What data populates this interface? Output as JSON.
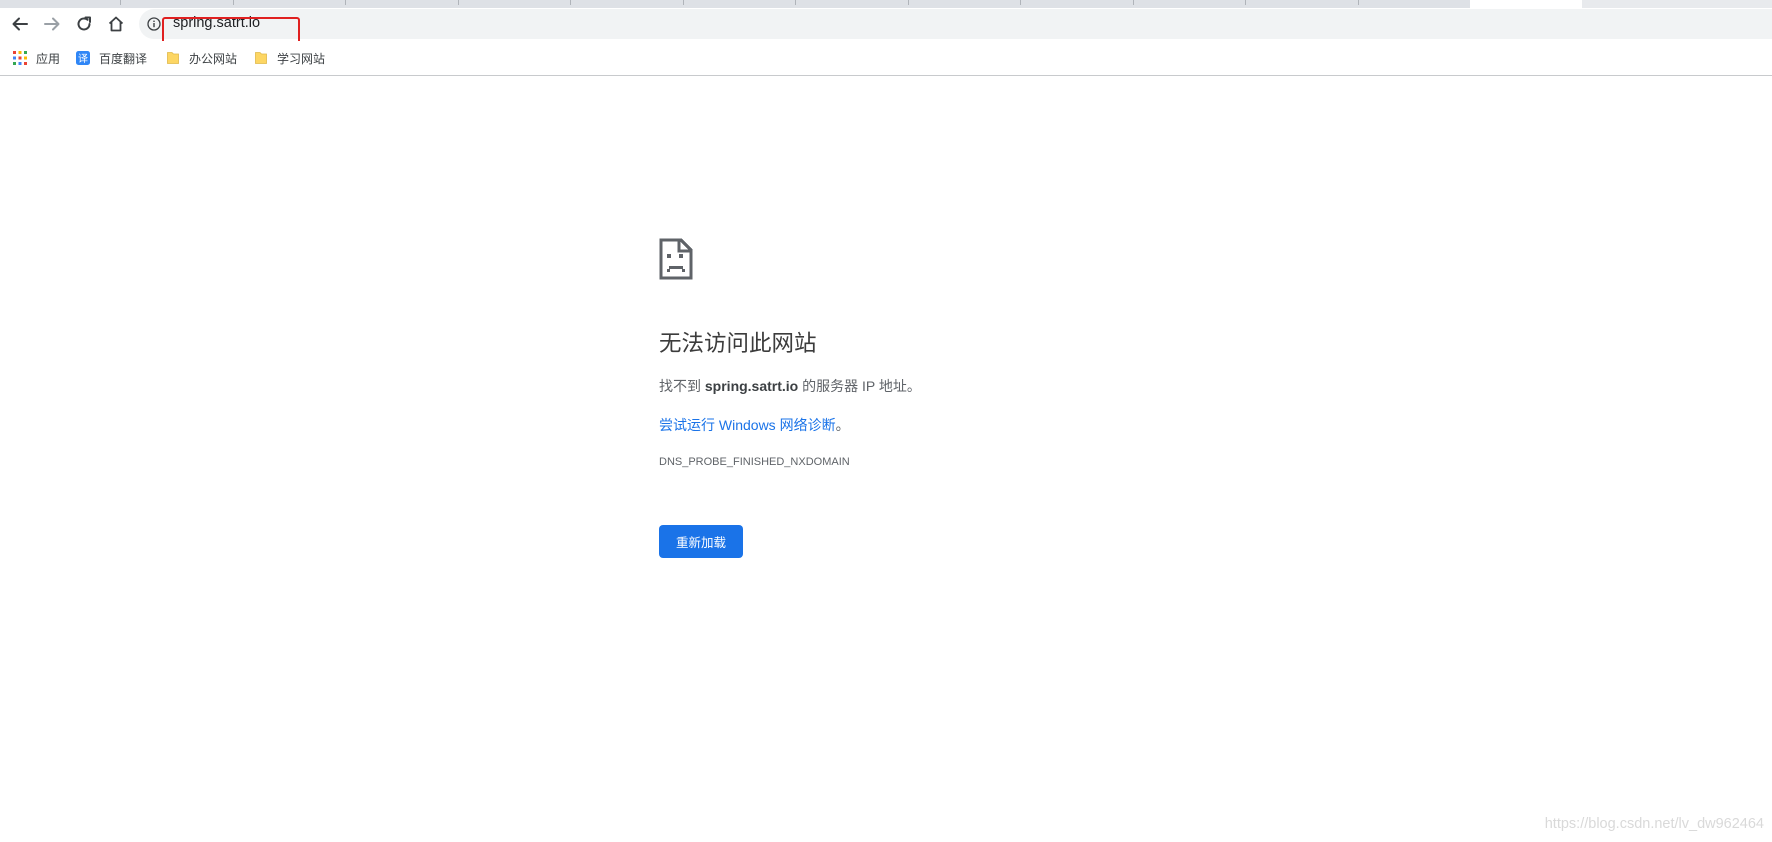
{
  "browser": {
    "url": "spring.satrt.io",
    "bookmarks": [
      {
        "label": "应用",
        "icon": "apps-grid-icon"
      },
      {
        "label": "百度翻译",
        "icon": "translate-icon"
      },
      {
        "label": "办公网站",
        "icon": "folder-icon"
      },
      {
        "label": "学习网站",
        "icon": "folder-icon"
      }
    ]
  },
  "error_page": {
    "title": "无法访问此网站",
    "desc_prefix": "找不到 ",
    "desc_host": "spring.satrt.io",
    "desc_suffix": " 的服务器 IP 地址。",
    "suggestion_link": "尝试运行 Windows 网络诊断",
    "suggestion_tail": "。",
    "error_code": "DNS_PROBE_FINISHED_NXDOMAIN",
    "reload_label": "重新加载"
  },
  "watermark": "https://blog.csdn.net/lv_dw962464",
  "colors": {
    "accent": "#1a73e8",
    "highlight_box": "#e02020"
  }
}
